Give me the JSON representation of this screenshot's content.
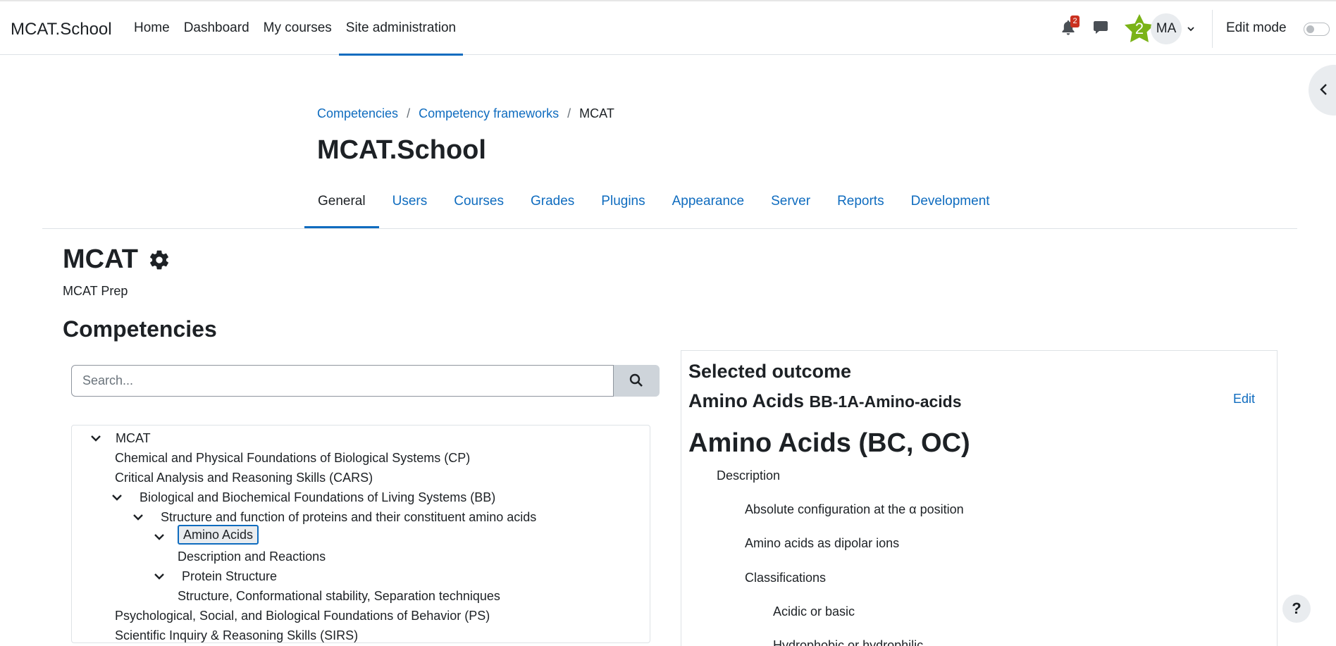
{
  "navbar": {
    "brand": "MCAT.School",
    "links": [
      {
        "label": "Home"
      },
      {
        "label": "Dashboard"
      },
      {
        "label": "My courses"
      },
      {
        "label": "Site administration"
      }
    ],
    "notification_count": "2",
    "level": "2",
    "avatar_initials": "MA",
    "edit_mode_label": "Edit mode",
    "edit_mode_on": false
  },
  "breadcrumb": {
    "items": [
      "Competencies",
      "Competency frameworks"
    ],
    "current": "MCAT"
  },
  "page_header": "MCAT.School",
  "secondary_tabs": [
    {
      "label": "General"
    },
    {
      "label": "Users"
    },
    {
      "label": "Courses"
    },
    {
      "label": "Grades"
    },
    {
      "label": "Plugins"
    },
    {
      "label": "Appearance"
    },
    {
      "label": "Server"
    },
    {
      "label": "Reports"
    },
    {
      "label": "Development"
    }
  ],
  "framework": {
    "title": "MCAT",
    "description": "MCAT Prep"
  },
  "competencies_heading": "Competencies",
  "search": {
    "placeholder": "Search..."
  },
  "tree": [
    {
      "label": "MCAT"
    },
    {
      "label": "Chemical and Physical Foundations of Biological Systems (CP)"
    },
    {
      "label": "Critical Analysis and Reasoning Skills (CARS)"
    },
    {
      "label": "Biological and Biochemical Foundations of Living Systems (BB)"
    },
    {
      "label": "Structure and function of proteins and their constituent amino acids"
    },
    {
      "label": "Amino Acids"
    },
    {
      "label": "Description and Reactions"
    },
    {
      "label": "Protein Structure"
    },
    {
      "label": "Structure, Conformational stability, Separation techniques"
    },
    {
      "label": "Psychological, Social, and Biological Foundations of Behavior (PS)"
    },
    {
      "label": "Scientific Inquiry & Reasoning Skills (SIRS)"
    }
  ],
  "detail": {
    "heading": "Selected outcome",
    "name": "Amino Acids",
    "idnumber": "BB-1A-Amino-acids",
    "edit_label": "Edit",
    "big_title": "Amino Acids (BC, OC)",
    "items": [
      "Description",
      "Absolute configuration at the α position",
      "Amino acids as dipolar ions",
      "Classifications",
      "Acidic or basic",
      "Hydrophobic or hydrophilic"
    ]
  },
  "help_label": "?"
}
